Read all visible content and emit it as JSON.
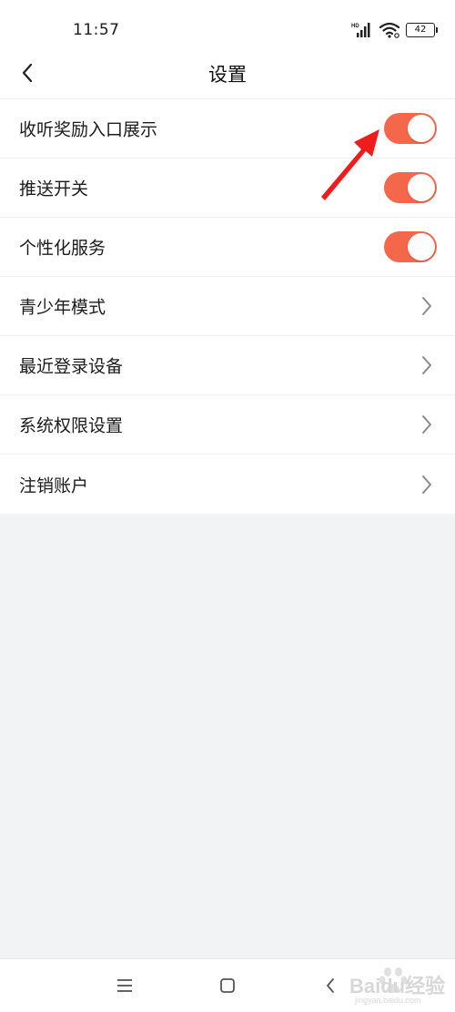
{
  "status_bar": {
    "time": "11:57",
    "network_label": "HD",
    "battery": "42"
  },
  "header": {
    "title": "设置"
  },
  "settings": {
    "items": [
      {
        "label": "收听奖励入口展示",
        "control": "toggle",
        "on": true
      },
      {
        "label": "推送开关",
        "control": "toggle",
        "on": true
      },
      {
        "label": "个性化服务",
        "control": "toggle",
        "on": true
      },
      {
        "label": "青少年模式",
        "control": "chevron"
      },
      {
        "label": "最近登录设备",
        "control": "chevron"
      },
      {
        "label": "系统权限设置",
        "control": "chevron"
      },
      {
        "label": "注销账户",
        "control": "chevron"
      }
    ]
  },
  "watermark": {
    "brand": "Baidu经验",
    "url": "jingyan.baidu.com"
  },
  "colors": {
    "toggle_on": "#f4674a",
    "annotation_arrow": "#ee1c1c",
    "background": "#f2f3f5"
  }
}
